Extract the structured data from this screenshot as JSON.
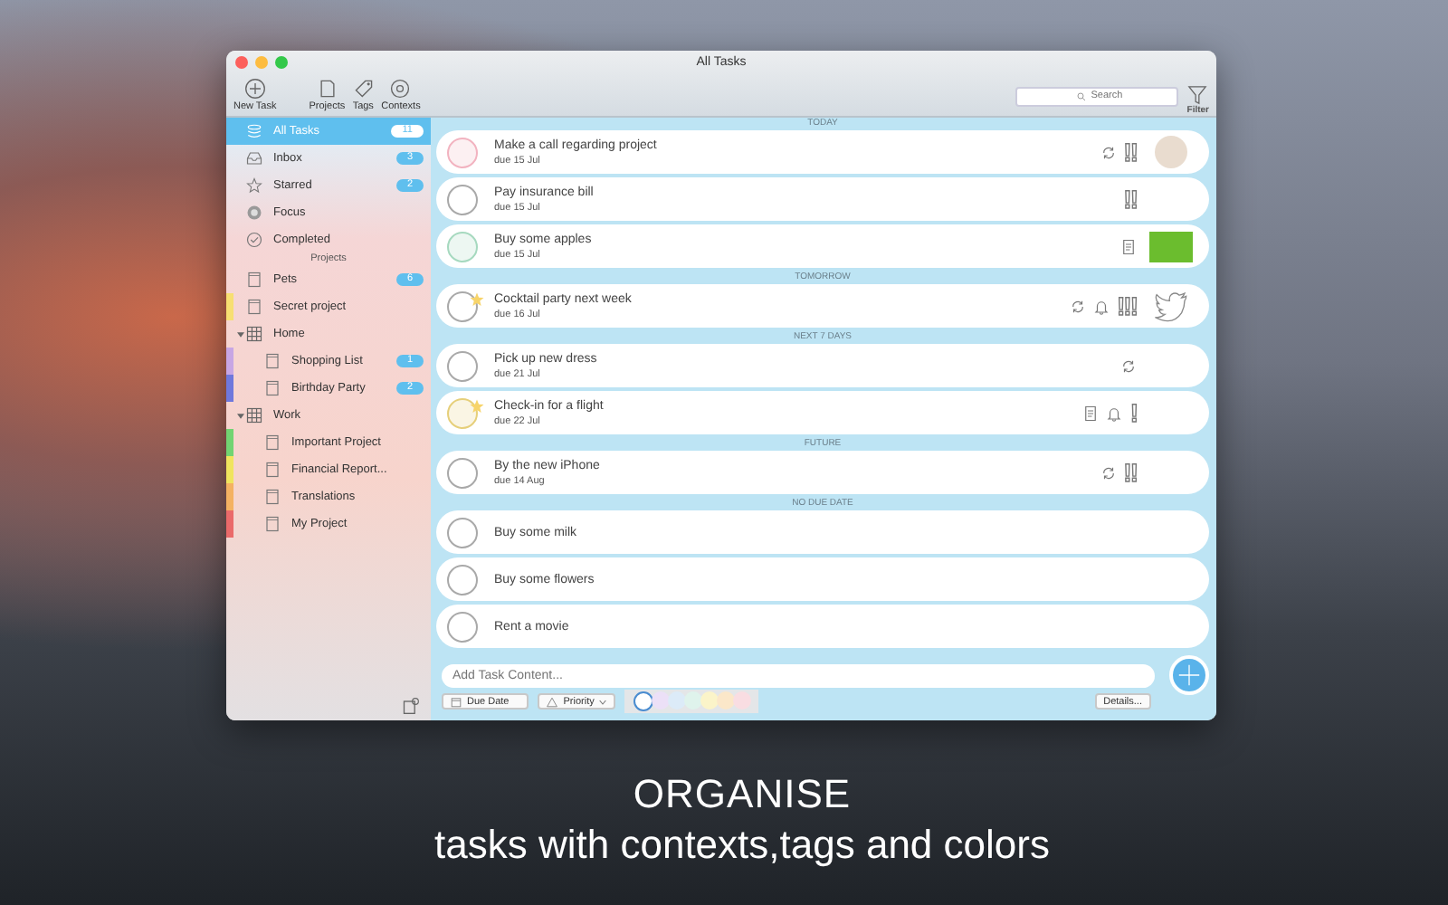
{
  "window": {
    "title": "All Tasks"
  },
  "toolbar": {
    "buttons": [
      {
        "kind": "new-task",
        "label": "New Task"
      },
      {
        "kind": "projects",
        "label": "Projects"
      },
      {
        "kind": "tags",
        "label": "Tags"
      },
      {
        "kind": "contexts",
        "label": "Contexts"
      }
    ],
    "search": {
      "placeholder": "Search"
    },
    "filter": {
      "label": "Filter"
    }
  },
  "sidebar": {
    "items": [
      {
        "kind": "all",
        "label": "All Tasks",
        "badge": "11",
        "selected": true
      },
      {
        "kind": "inbox",
        "label": "Inbox",
        "badge": "3",
        "selected": false
      },
      {
        "kind": "starred",
        "label": "Starred",
        "badge": "2",
        "selected": false
      },
      {
        "kind": "focus",
        "label": "Focus",
        "selected": false
      },
      {
        "kind": "completed",
        "label": "Completed",
        "selected": false
      }
    ],
    "projects_header": "Projects",
    "projects": [
      {
        "kind": "project",
        "label": "Pets",
        "badge": "6",
        "selected": false
      },
      {
        "kind": "project",
        "label": "Secret project",
        "color": "#f7df72",
        "selected": false
      },
      {
        "kind": "group",
        "label": "Home",
        "expanded": true,
        "selected": false,
        "children": [
          {
            "kind": "project",
            "label": "Shopping List",
            "badge": "1",
            "color": "#c7a6e4",
            "selected": false
          },
          {
            "kind": "project",
            "label": "Birthday Party",
            "badge": "2",
            "color": "#6f78dc",
            "selected": false
          }
        ]
      },
      {
        "kind": "group",
        "label": "Work",
        "expanded": true,
        "selected": false,
        "children": [
          {
            "kind": "project",
            "label": "Important Project",
            "color": "#72d472",
            "selected": false
          },
          {
            "kind": "project",
            "label": "Financial Report...",
            "color": "#f0e45e",
            "selected": false
          },
          {
            "kind": "project",
            "label": "Translations",
            "color": "#f4b262",
            "selected": false
          },
          {
            "kind": "project",
            "label": "My Project",
            "color": "#ea6a6a",
            "selected": false
          }
        ]
      }
    ]
  },
  "sections": [
    {
      "title": "TODAY",
      "tasks": [
        {
          "title": "Make a call regarding project",
          "due": "due 15 Jul",
          "starred": false,
          "color": "#f2b3c0",
          "icons": [
            {
              "kind": "repeat"
            }
          ],
          "priority": "!!",
          "attachment": {
            "kind": "photo"
          }
        },
        {
          "title": "Pay insurance bill",
          "due": "due 15 Jul",
          "starred": false,
          "color": "#a9a9a9",
          "priority": "!!"
        },
        {
          "title": "Buy some apples",
          "due": "due 15 Jul",
          "starred": false,
          "color": "#a6d9bf",
          "icons": [
            {
              "kind": "note"
            }
          ],
          "attachment": {
            "kind": "image"
          }
        }
      ]
    },
    {
      "title": "TOMORROW",
      "tasks": [
        {
          "title": "Cocktail party next week",
          "due": "due 16 Jul",
          "starred": true,
          "color": "#a9a9a9",
          "icons": [
            {
              "kind": "repeat"
            },
            {
              "kind": "alarm"
            }
          ],
          "priority": "!!!",
          "attachment": {
            "kind": "bird"
          }
        }
      ]
    },
    {
      "title": "NEXT 7 DAYS",
      "tasks": [
        {
          "title": "Pick up new dress",
          "due": "due 21 Jul",
          "starred": false,
          "color": "#a9a9a9",
          "icons": [
            {
              "kind": "repeat"
            }
          ]
        },
        {
          "title": "Check-in for a flight",
          "due": "due 22 Jul",
          "starred": true,
          "color": "#e6cf7a",
          "icons": [
            {
              "kind": "note"
            },
            {
              "kind": "alarm"
            }
          ],
          "priority": "!"
        }
      ]
    },
    {
      "title": "FUTURE",
      "tasks": [
        {
          "title": "By the new iPhone",
          "due": "due 14 Aug",
          "starred": false,
          "color": "#a9a9a9",
          "icons": [
            {
              "kind": "repeat"
            }
          ],
          "priority": "!!"
        }
      ]
    },
    {
      "title": "NO DUE DATE",
      "tasks": [
        {
          "title": "Buy some milk",
          "starred": false,
          "color": "#a9a9a9"
        },
        {
          "title": "Buy some flowers",
          "starred": false,
          "color": "#a9a9a9"
        },
        {
          "title": "Rent a movie",
          "starred": false,
          "color": "#a9a9a9"
        }
      ]
    }
  ],
  "composer": {
    "placeholder": "Add Task Content...",
    "due_date": "Due Date",
    "priority": "Priority",
    "details": "Details...",
    "colors": [
      {
        "color": "#ffffff",
        "selected": true
      },
      {
        "color": "#ece0f7",
        "selected": false
      },
      {
        "color": "#dcebf8",
        "selected": false
      },
      {
        "color": "#dff3ec",
        "selected": false
      },
      {
        "color": "#fbf4c9",
        "selected": false
      },
      {
        "color": "#fbe7c9",
        "selected": false
      },
      {
        "color": "#f9dde2",
        "selected": false
      }
    ]
  },
  "caption": {
    "headline": "ORGANISE",
    "subline": "tasks with contexts,tags and colors"
  }
}
